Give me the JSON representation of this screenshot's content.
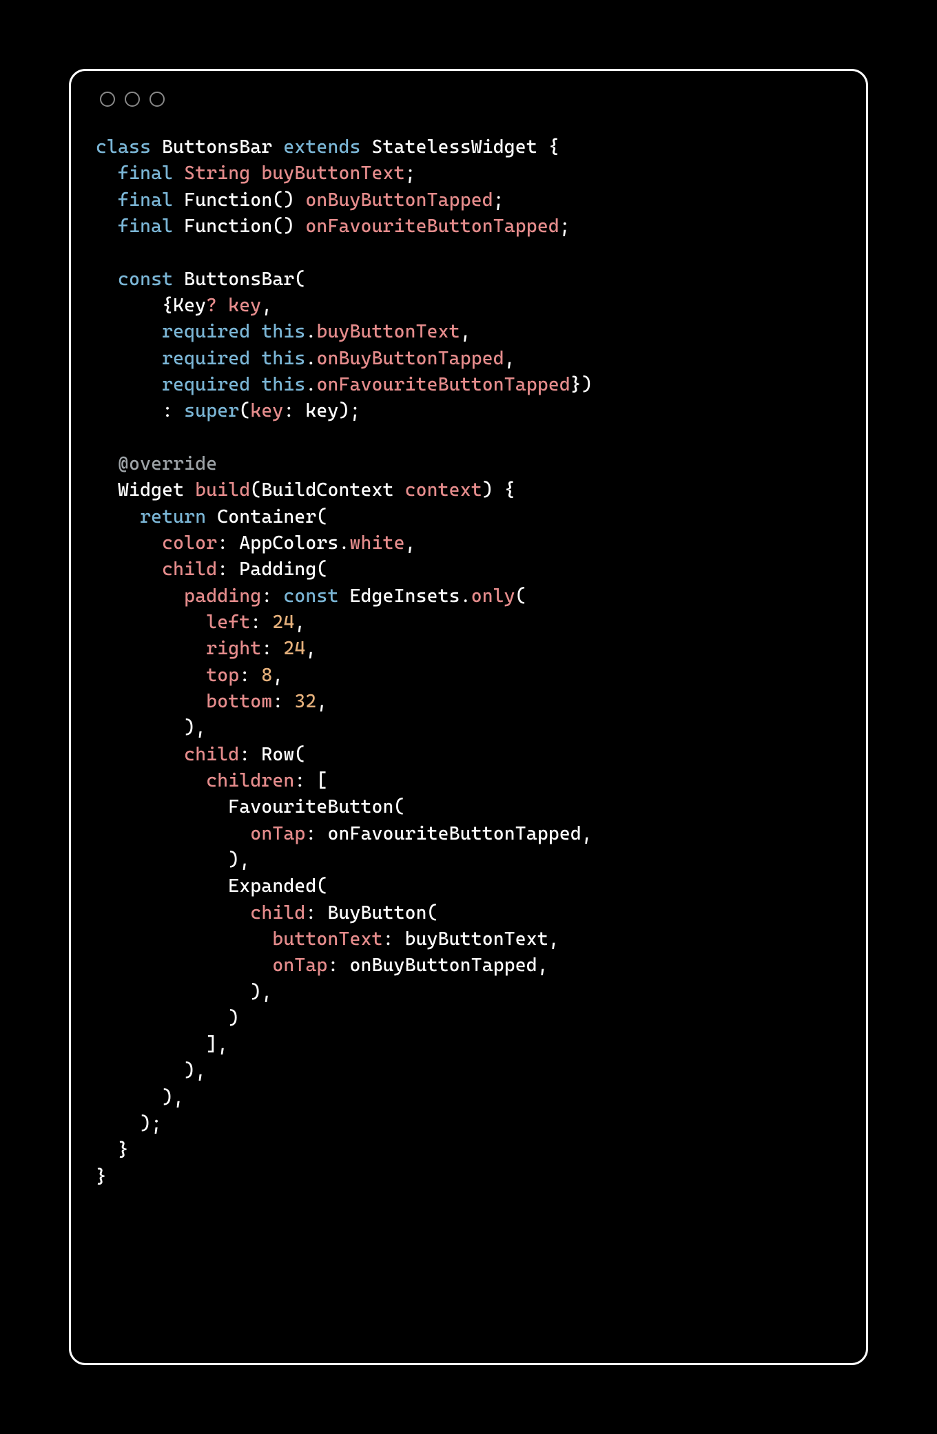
{
  "code": {
    "l1": {
      "a": "class ",
      "b": "ButtonsBar ",
      "c": "extends ",
      "d": "StatelessWidget {"
    },
    "l2": {
      "a": "  ",
      "b": "final ",
      "c": "String ",
      "d": "buyButtonText",
      "e": ";"
    },
    "l3": {
      "a": "  ",
      "b": "final ",
      "c": "Function() ",
      "d": "onBuyButtonTapped",
      "e": ";"
    },
    "l4": {
      "a": "  ",
      "b": "final ",
      "c": "Function() ",
      "d": "onFavouriteButtonTapped",
      "e": ";"
    },
    "l6": {
      "a": "  ",
      "b": "const ",
      "c": "ButtonsBar("
    },
    "l7": {
      "a": "      {Key",
      "q": "?",
      "c": " key",
      "d": ","
    },
    "l8": {
      "a": "      ",
      "b": "required ",
      "c": "this",
      "d": ".",
      "e": "buyButtonText",
      "f": ","
    },
    "l9": {
      "a": "      ",
      "b": "required ",
      "c": "this",
      "d": ".",
      "e": "onBuyButtonTapped",
      "f": ","
    },
    "l10": {
      "a": "      ",
      "b": "required ",
      "c": "this",
      "d": ".",
      "e": "onFavouriteButtonTapped",
      "f": "})"
    },
    "l11": {
      "a": "      : ",
      "b": "super",
      "c": "(",
      "d": "key",
      "e": ": key);"
    },
    "l13": {
      "a": "  ",
      "b": "@override"
    },
    "l14": {
      "a": "  Widget ",
      "b": "build",
      "c": "(BuildContext ",
      "d": "context",
      "e": ") {"
    },
    "l15": {
      "a": "    ",
      "b": "return ",
      "c": "Container("
    },
    "l16": {
      "a": "      ",
      "b": "color",
      "c": ": AppColors.",
      "d": "white",
      "e": ","
    },
    "l17": {
      "a": "      ",
      "b": "child",
      "c": ": Padding("
    },
    "l18": {
      "a": "        ",
      "b": "padding",
      "c": ": ",
      "d": "const ",
      "e": "EdgeInsets.",
      "f": "only",
      "g": "("
    },
    "l19": {
      "a": "          ",
      "b": "left",
      "c": ": ",
      "d": "24",
      "e": ","
    },
    "l20": {
      "a": "          ",
      "b": "right",
      "c": ": ",
      "d": "24",
      "e": ","
    },
    "l21": {
      "a": "          ",
      "b": "top",
      "c": ": ",
      "d": "8",
      "e": ","
    },
    "l22": {
      "a": "          ",
      "b": "bottom",
      "c": ": ",
      "d": "32",
      "e": ","
    },
    "l23": {
      "a": "        ),"
    },
    "l24": {
      "a": "        ",
      "b": "child",
      "c": ": Row("
    },
    "l25": {
      "a": "          ",
      "b": "children",
      "c": ": ["
    },
    "l26": {
      "a": "            FavouriteButton("
    },
    "l27": {
      "a": "              ",
      "b": "onTap",
      "c": ": onFavouriteButtonTapped,"
    },
    "l28": {
      "a": "            ),"
    },
    "l29": {
      "a": "            Expanded("
    },
    "l30": {
      "a": "              ",
      "b": "child",
      "c": ": BuyButton("
    },
    "l31": {
      "a": "                ",
      "b": "buttonText",
      "c": ": buyButtonText,"
    },
    "l32": {
      "a": "                ",
      "b": "onTap",
      "c": ": onBuyButtonTapped,"
    },
    "l33": {
      "a": "              ),"
    },
    "l34": {
      "a": "            )"
    },
    "l35": {
      "a": "          ],"
    },
    "l36": {
      "a": "        ),"
    },
    "l37": {
      "a": "      ),"
    },
    "l38": {
      "a": "    );"
    },
    "l39": {
      "a": "  }"
    },
    "l40": {
      "a": "}"
    }
  }
}
